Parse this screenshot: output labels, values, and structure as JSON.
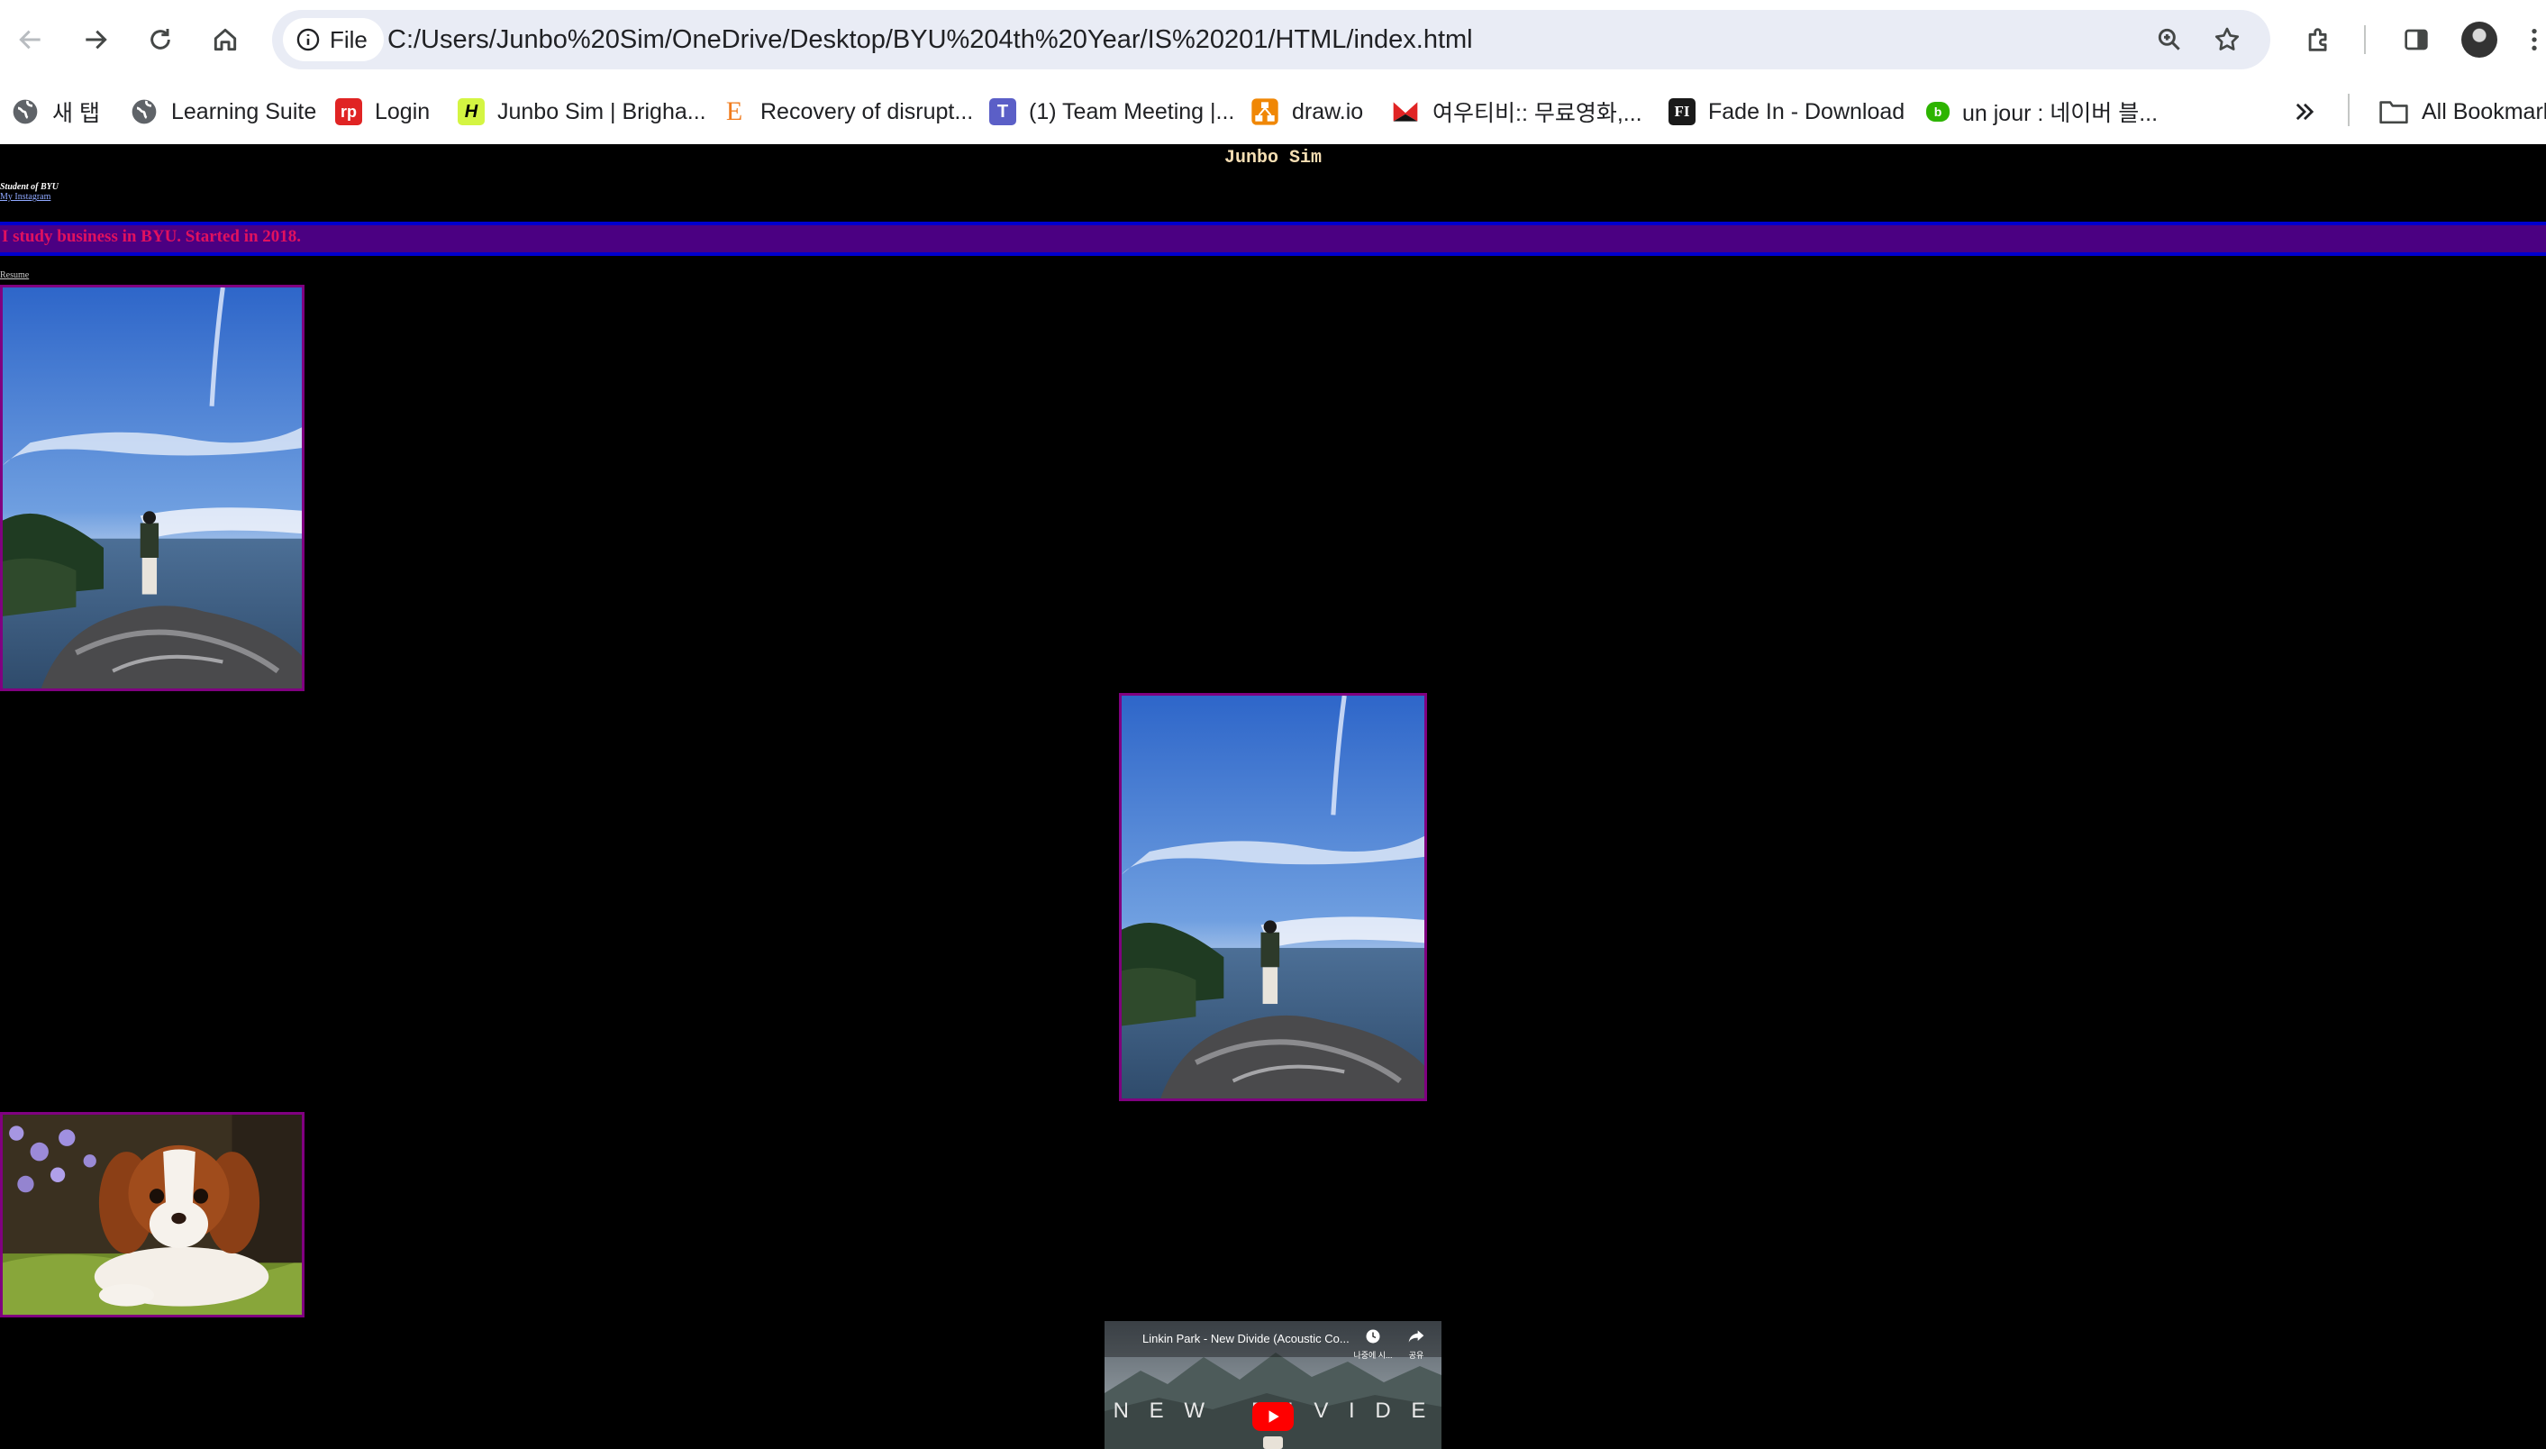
{
  "browser": {
    "url_chip": "File",
    "url": "C:/Users/Junbo%20Sim/OneDrive/Desktop/BYU%204th%20Year/IS%20201/HTML/index.html",
    "bookmarks": [
      {
        "label": "새 탭",
        "icon": "globe-icon"
      },
      {
        "label": "Learning Suite",
        "icon": "globe-icon"
      },
      {
        "label": "Login",
        "icon": "rp-icon",
        "badge": "rp",
        "color": "#e02424"
      },
      {
        "label": "Junbo Sim | Brigha...",
        "icon": "h-icon",
        "badge": "H",
        "color": "#d4f542"
      },
      {
        "label": "Recovery of disrupt...",
        "icon": "e-icon",
        "badge": "E",
        "color": "#f07c1e"
      },
      {
        "label": "(1) Team Meeting |...",
        "icon": "teams-icon",
        "badge": "T",
        "color": "#5b5fc7"
      },
      {
        "label": "draw.io",
        "icon": "drawio-icon",
        "color": "#f08705"
      },
      {
        "label": "여우티비:: 무료영화,...",
        "icon": "fox-icon",
        "color": "#e02424"
      },
      {
        "label": "Fade In - Download",
        "icon": "fadein-icon",
        "badge": "FI",
        "color": "#1a1a1a"
      },
      {
        "label": "un jour : 네이버 블...",
        "icon": "blog-icon",
        "badge": "b",
        "color": "#2db400"
      }
    ],
    "all_bookmarks": "All Bookmarks"
  },
  "page": {
    "title": "Junbo Sim",
    "subtitle": "Student of BYU",
    "instagram_link": "My Instagram",
    "banner": "I study business in BYU. Started in 2018.",
    "resume_link": "Resume",
    "photo_left_alt": "Person standing on coastal rock",
    "photo_center_alt": "Person standing on coastal rock",
    "puppy_alt": "Cavalier King Charles puppy",
    "video": {
      "title": "Linkin Park - New Divide (Acoustic Co...",
      "watch_later": "나중에 시...",
      "share": "공유",
      "overlay": "N E W   D I V I D E"
    }
  }
}
